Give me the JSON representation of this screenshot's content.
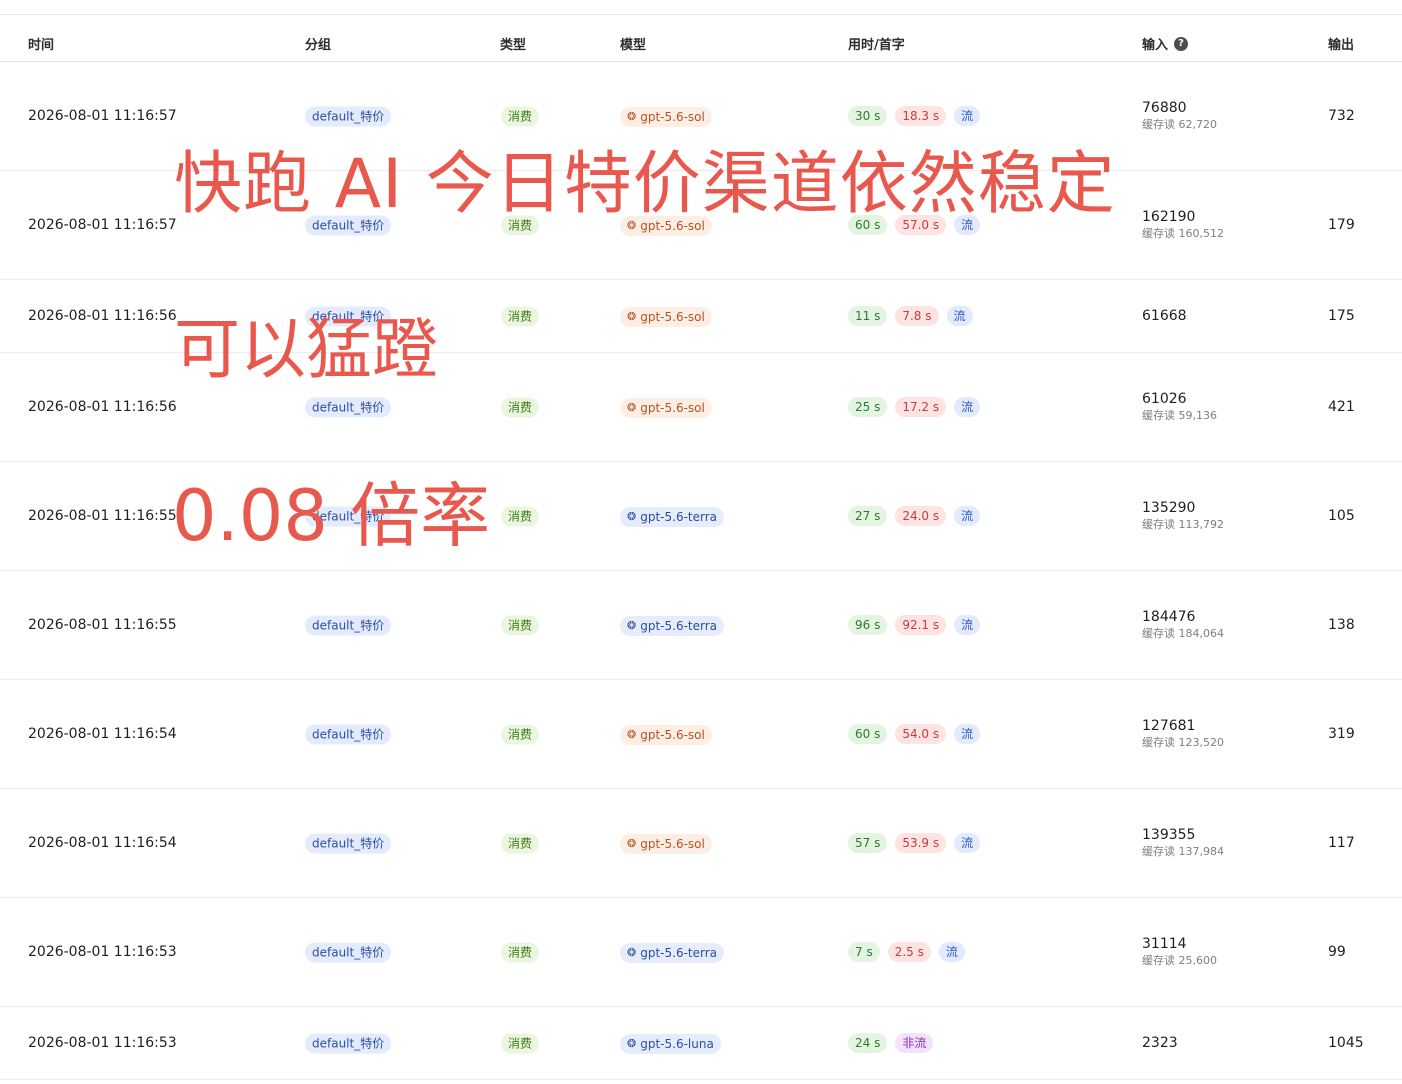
{
  "headers": {
    "time": "时间",
    "group": "分组",
    "type": "类型",
    "model": "模型",
    "timing": "用时/首字",
    "input": "输入",
    "output": "输出"
  },
  "rows": [
    {
      "time": "2026-08-01 11:16:57",
      "group": "default_特价",
      "type": "消费",
      "model": "gpt-5.6-sol",
      "model_style": "warm",
      "duration": "30 s",
      "first_token": "18.3 s",
      "mode": "流",
      "input": "76880",
      "cache": "缓存读 62,720",
      "output": "732"
    },
    {
      "time": "2026-08-01 11:16:57",
      "group": "default_特价",
      "type": "消费",
      "model": "gpt-5.6-sol",
      "model_style": "warm",
      "duration": "60 s",
      "first_token": "57.0 s",
      "mode": "流",
      "input": "162190",
      "cache": "缓存读 160,512",
      "output": "179"
    },
    {
      "time": "2026-08-01 11:16:56",
      "group": "default_特价",
      "type": "消费",
      "model": "gpt-5.6-sol",
      "model_style": "warm",
      "duration": "11 s",
      "first_token": "7.8 s",
      "mode": "流",
      "input": "61668",
      "cache": "",
      "output": "175"
    },
    {
      "time": "2026-08-01 11:16:56",
      "group": "default_特价",
      "type": "消费",
      "model": "gpt-5.6-sol",
      "model_style": "warm",
      "duration": "25 s",
      "first_token": "17.2 s",
      "mode": "流",
      "input": "61026",
      "cache": "缓存读 59,136",
      "output": "421"
    },
    {
      "time": "2026-08-01 11:16:55",
      "group": "default_特价",
      "type": "消费",
      "model": "gpt-5.6-terra",
      "model_style": "cool",
      "duration": "27 s",
      "first_token": "24.0 s",
      "mode": "流",
      "input": "135290",
      "cache": "缓存读 113,792",
      "output": "105"
    },
    {
      "time": "2026-08-01 11:16:55",
      "group": "default_特价",
      "type": "消费",
      "model": "gpt-5.6-terra",
      "model_style": "cool",
      "duration": "96 s",
      "first_token": "92.1 s",
      "mode": "流",
      "input": "184476",
      "cache": "缓存读 184,064",
      "output": "138"
    },
    {
      "time": "2026-08-01 11:16:54",
      "group": "default_特价",
      "type": "消费",
      "model": "gpt-5.6-sol",
      "model_style": "warm",
      "duration": "60 s",
      "first_token": "54.0 s",
      "mode": "流",
      "input": "127681",
      "cache": "缓存读 123,520",
      "output": "319"
    },
    {
      "time": "2026-08-01 11:16:54",
      "group": "default_特价",
      "type": "消费",
      "model": "gpt-5.6-sol",
      "model_style": "warm",
      "duration": "57 s",
      "first_token": "53.9 s",
      "mode": "流",
      "input": "139355",
      "cache": "缓存读 137,984",
      "output": "117"
    },
    {
      "time": "2026-08-01 11:16:53",
      "group": "default_特价",
      "type": "消费",
      "model": "gpt-5.6-terra",
      "model_style": "cool",
      "duration": "7 s",
      "first_token": "2.5 s",
      "mode": "流",
      "input": "31114",
      "cache": "缓存读 25,600",
      "output": "99"
    },
    {
      "time": "2026-08-01 11:16:53",
      "group": "default_特价",
      "type": "消费",
      "model": "gpt-5.6-luna",
      "model_style": "cool",
      "duration": "24 s",
      "first_token": "",
      "mode": "非流",
      "input": "2323",
      "cache": "",
      "output": "1045"
    }
  ],
  "overlay": {
    "line1": "快跑 AI 今日特价渠道依然稳定",
    "line2": "可以猛蹬",
    "line3": "0.08 倍率"
  },
  "colors": {
    "overlay_text": "#e8584d",
    "group_tag": "#e3ebfd",
    "type_tag": "#eaf6df",
    "model_warm": "#fdeee4",
    "model_cool": "#e5ecfc"
  }
}
